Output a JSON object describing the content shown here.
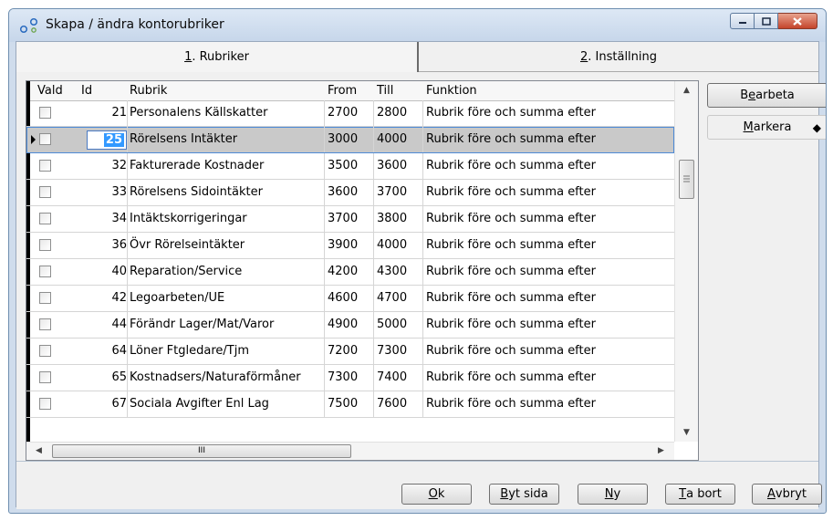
{
  "window": {
    "title": "Skapa / ändra kontorubriker"
  },
  "tabs": [
    {
      "key": "1",
      "rest": ". Rubriker"
    },
    {
      "key": "2",
      "rest": ". Inställning"
    }
  ],
  "grid": {
    "columns": [
      "Vald",
      "Id",
      "Rubrik",
      "From",
      "Till",
      "Funktion"
    ],
    "rows": [
      {
        "id": "21",
        "rubrik": "Personalens Källskatter",
        "from": "2700",
        "till": "2800",
        "funktion": "Rubrik före och summa efter"
      },
      {
        "id": "25",
        "rubrik": "Rörelsens Intäkter",
        "from": "3000",
        "till": "4000",
        "funktion": "Rubrik före och summa efter"
      },
      {
        "id": "32",
        "rubrik": "Fakturerade Kostnader",
        "from": "3500",
        "till": "3600",
        "funktion": "Rubrik före och summa efter"
      },
      {
        "id": "33",
        "rubrik": "Rörelsens Sidointäkter",
        "from": "3600",
        "till": "3700",
        "funktion": "Rubrik före och summa efter"
      },
      {
        "id": "34",
        "rubrik": "Intäktskorrigeringar",
        "from": "3700",
        "till": "3800",
        "funktion": "Rubrik före och summa efter"
      },
      {
        "id": "36",
        "rubrik": "Övr Rörelseintäkter",
        "from": "3900",
        "till": "4000",
        "funktion": "Rubrik före och summa efter"
      },
      {
        "id": "40",
        "rubrik": "Reparation/Service",
        "from": "4200",
        "till": "4300",
        "funktion": "Rubrik före och summa efter"
      },
      {
        "id": "42",
        "rubrik": "Legoarbeten/UE",
        "from": "4600",
        "till": "4700",
        "funktion": "Rubrik före och summa efter"
      },
      {
        "id": "44",
        "rubrik": "Förändr Lager/Mat/Varor",
        "from": "4900",
        "till": "5000",
        "funktion": "Rubrik före och summa efter"
      },
      {
        "id": "64",
        "rubrik": "Löner Ftgledare/Tjm",
        "from": "7200",
        "till": "7300",
        "funktion": "Rubrik före och summa efter"
      },
      {
        "id": "65",
        "rubrik": "Kostnadsers/Naturaförmåner",
        "from": "7300",
        "till": "7400",
        "funktion": "Rubrik före och summa efter"
      },
      {
        "id": "67",
        "rubrik": "Sociala Avgifter Enl Lag",
        "from": "7500",
        "till": "7600",
        "funktion": "Rubrik före och summa efter"
      }
    ],
    "hscroll_grip": "III"
  },
  "side_buttons": {
    "bearbeta": {
      "pre": "B",
      "key": "e",
      "post": "arbeta"
    },
    "markera": {
      "pre": "",
      "key": "M",
      "post": "arkera",
      "marker": "◆"
    }
  },
  "footer_buttons": {
    "ok": {
      "key": "O",
      "post": "k"
    },
    "byt_sida": {
      "key": "B",
      "post": "yt sida"
    },
    "ny": {
      "key": "N",
      "post": "y"
    },
    "ta_bort": {
      "key": "T",
      "post": "a bort"
    },
    "avbryt": {
      "key": "A",
      "post": "vbryt"
    }
  }
}
